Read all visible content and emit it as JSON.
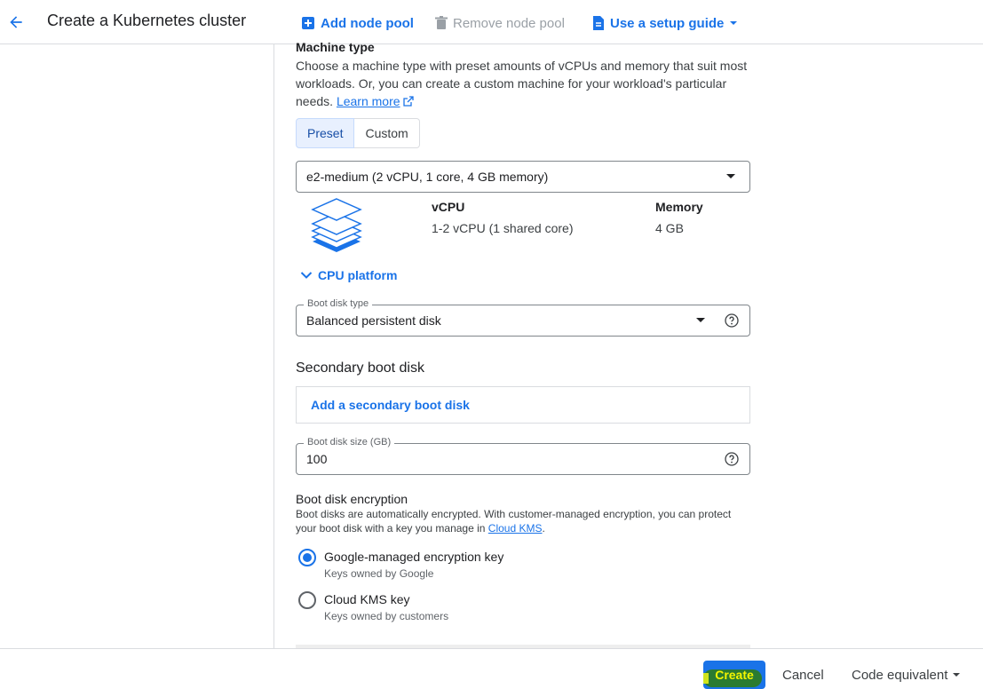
{
  "header": {
    "title": "Create a Kubernetes cluster",
    "add_node_pool": "Add node pool",
    "remove_node_pool": "Remove node pool",
    "setup_guide": "Use a setup guide"
  },
  "machine": {
    "section_title": "Machine type",
    "description": "Choose a machine type with preset amounts of vCPUs and memory that suit most workloads. Or, you can create a custom machine for your workload's particular needs.",
    "learn_more": "Learn more",
    "tab_preset": "Preset",
    "tab_custom": "Custom",
    "selected_type": "e2-medium (2 vCPU, 1 core, 4 GB memory)",
    "vcpu_header": "vCPU",
    "vcpu_value": "1-2 vCPU (1 shared core)",
    "memory_header": "Memory",
    "memory_value": "4 GB",
    "cpu_platform": "CPU platform"
  },
  "boot_disk": {
    "type_label": "Boot disk type",
    "type_value": "Balanced persistent disk",
    "secondary_title": "Secondary boot disk",
    "add_secondary": "Add a secondary boot disk",
    "size_label": "Boot disk size (GB)",
    "size_value": "100"
  },
  "encryption": {
    "title": "Boot disk encryption",
    "desc_prefix": "Boot disks are automatically encrypted. With customer-managed encryption, you can protect your boot disk with a key you manage in ",
    "desc_link": "Cloud KMS",
    "desc_suffix": ".",
    "options": [
      {
        "label": "Google-managed encryption key",
        "sub": "Keys owned by Google",
        "checked": true
      },
      {
        "label": "Cloud KMS key",
        "sub": "Keys owned by customers",
        "checked": false
      }
    ]
  },
  "footer": {
    "create": "Create",
    "cancel": "Cancel",
    "code_equivalent": "Code equivalent"
  },
  "colors": {
    "accent": "#1a73e8",
    "selected_tab_bg": "#e8f0fe"
  }
}
